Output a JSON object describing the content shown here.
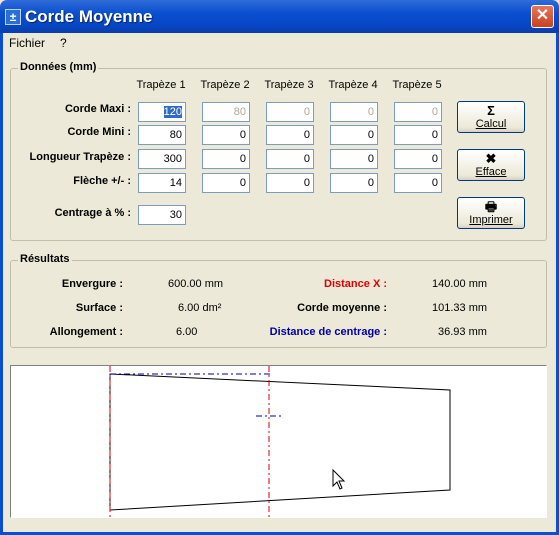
{
  "window": {
    "title": "Corde Moyenne",
    "close_glyph": "✕"
  },
  "menu": {
    "items": [
      "Fichier",
      "?"
    ]
  },
  "donnees": {
    "legend": "Données (mm)",
    "columns": [
      "Trapèze 1",
      "Trapèze 2",
      "Trapèze 3",
      "Trapèze 4",
      "Trapèze 5"
    ],
    "rows": [
      {
        "label": "Corde Maxi :",
        "values": [
          "120",
          "80",
          "0",
          "0",
          "0"
        ]
      },
      {
        "label": "Corde Mini :",
        "values": [
          "80",
          "0",
          "0",
          "0",
          "0"
        ]
      },
      {
        "label": "Longueur Trapèze :",
        "values": [
          "300",
          "0",
          "0",
          "0",
          "0"
        ]
      },
      {
        "label": "Flèche  +/- :",
        "values": [
          "14",
          "0",
          "0",
          "0",
          "0"
        ]
      }
    ],
    "centrage_label": "Centrage à  % :",
    "centrage_value": "30"
  },
  "buttons": {
    "calcul": {
      "label": "Calcul",
      "icon": "sigma-icon",
      "glyph": "Σ"
    },
    "efface": {
      "label": "Efface",
      "icon": "x-icon",
      "glyph": "✖"
    },
    "imprimer": {
      "label": "Imprimer",
      "icon": "printer-icon",
      "glyph": "🖶"
    }
  },
  "resultats": {
    "legend": "Résultats",
    "envergure_label": "Envergure :",
    "envergure_value": "600.00 mm",
    "surface_label": "Surface :",
    "surface_value": "6.00 dm²",
    "allongement_label": "Allongement :",
    "allongement_value": "6.00",
    "distance_x_label": "Distance X :",
    "distance_x_value": "140.00 mm",
    "corde_moyenne_label": "Corde moyenne :",
    "corde_moyenne_value": "101.33 mm",
    "distance_centrage_label": "Distance de centrage :",
    "distance_centrage_value": "36.93 mm",
    "colors": {
      "distance_x": "#e00000",
      "distance_centrage": "#0000a0"
    }
  }
}
